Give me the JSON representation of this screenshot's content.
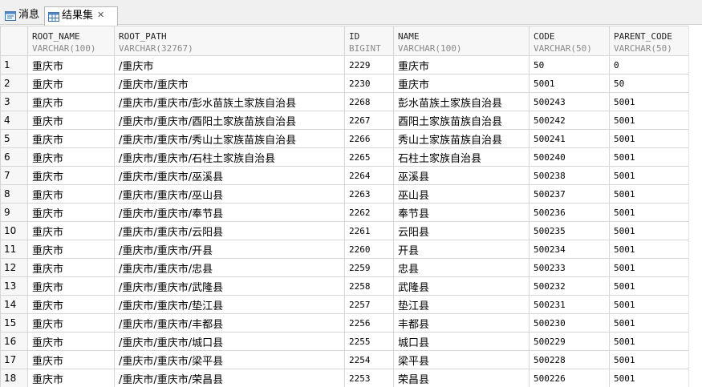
{
  "tabs": [
    {
      "label": "消息",
      "icon": "message-icon",
      "active": false
    },
    {
      "label": "结果集",
      "icon": "grid-icon",
      "active": true,
      "close": "✕"
    }
  ],
  "columns": [
    {
      "name": "ROOT_NAME",
      "type": "VARCHAR(100)"
    },
    {
      "name": "ROOT_PATH",
      "type": "VARCHAR(32767)"
    },
    {
      "name": "ID",
      "type": "BIGINT"
    },
    {
      "name": "NAME",
      "type": "VARCHAR(100)"
    },
    {
      "name": "CODE",
      "type": "VARCHAR(50)"
    },
    {
      "name": "PARENT_CODE",
      "type": "VARCHAR(50)"
    }
  ],
  "rows": [
    {
      "n": "1",
      "cells": [
        "重庆市",
        "/重庆市",
        "2229",
        "重庆市",
        "50",
        "0"
      ]
    },
    {
      "n": "2",
      "cells": [
        "重庆市",
        "/重庆市/重庆市",
        "2230",
        "重庆市",
        "5001",
        "50"
      ]
    },
    {
      "n": "3",
      "cells": [
        "重庆市",
        "/重庆市/重庆市/彭水苗族土家族自治县",
        "2268",
        "彭水苗族土家族自治县",
        "500243",
        "5001"
      ]
    },
    {
      "n": "4",
      "cells": [
        "重庆市",
        "/重庆市/重庆市/酉阳土家族苗族自治县",
        "2267",
        "酉阳土家族苗族自治县",
        "500242",
        "5001"
      ]
    },
    {
      "n": "5",
      "cells": [
        "重庆市",
        "/重庆市/重庆市/秀山土家族苗族自治县",
        "2266",
        "秀山土家族苗族自治县",
        "500241",
        "5001"
      ]
    },
    {
      "n": "6",
      "cells": [
        "重庆市",
        "/重庆市/重庆市/石柱土家族自治县",
        "2265",
        "石柱土家族自治县",
        "500240",
        "5001"
      ]
    },
    {
      "n": "7",
      "cells": [
        "重庆市",
        "/重庆市/重庆市/巫溪县",
        "2264",
        "巫溪县",
        "500238",
        "5001"
      ]
    },
    {
      "n": "8",
      "cells": [
        "重庆市",
        "/重庆市/重庆市/巫山县",
        "2263",
        "巫山县",
        "500237",
        "5001"
      ]
    },
    {
      "n": "9",
      "cells": [
        "重庆市",
        "/重庆市/重庆市/奉节县",
        "2262",
        "奉节县",
        "500236",
        "5001"
      ]
    },
    {
      "n": "10",
      "cells": [
        "重庆市",
        "/重庆市/重庆市/云阳县",
        "2261",
        "云阳县",
        "500235",
        "5001"
      ]
    },
    {
      "n": "11",
      "cells": [
        "重庆市",
        "/重庆市/重庆市/开县",
        "2260",
        "开县",
        "500234",
        "5001"
      ]
    },
    {
      "n": "12",
      "cells": [
        "重庆市",
        "/重庆市/重庆市/忠县",
        "2259",
        "忠县",
        "500233",
        "5001"
      ]
    },
    {
      "n": "13",
      "cells": [
        "重庆市",
        "/重庆市/重庆市/武隆县",
        "2258",
        "武隆县",
        "500232",
        "5001"
      ]
    },
    {
      "n": "14",
      "cells": [
        "重庆市",
        "/重庆市/重庆市/垫江县",
        "2257",
        "垫江县",
        "500231",
        "5001"
      ]
    },
    {
      "n": "15",
      "cells": [
        "重庆市",
        "/重庆市/重庆市/丰都县",
        "2256",
        "丰都县",
        "500230",
        "5001"
      ]
    },
    {
      "n": "16",
      "cells": [
        "重庆市",
        "/重庆市/重庆市/城口县",
        "2255",
        "城口县",
        "500229",
        "5001"
      ]
    },
    {
      "n": "17",
      "cells": [
        "重庆市",
        "/重庆市/重庆市/梁平县",
        "2254",
        "梁平县",
        "500228",
        "5001"
      ]
    },
    {
      "n": "18",
      "cells": [
        "重庆市",
        "/重庆市/重庆市/荣昌县",
        "2253",
        "荣昌县",
        "500226",
        "5001"
      ]
    }
  ]
}
